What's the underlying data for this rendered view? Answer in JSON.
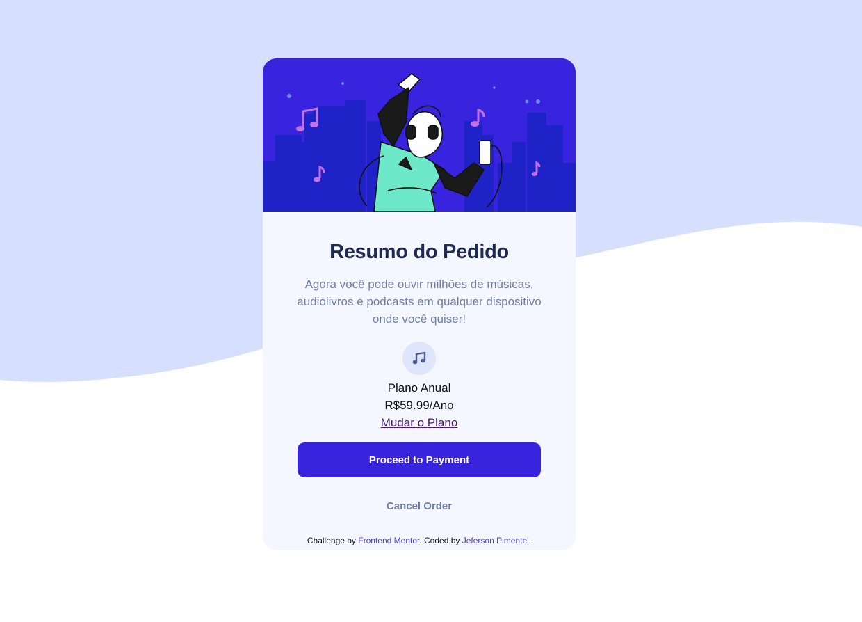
{
  "colors": {
    "page_background": "#ffffff",
    "wave": "#d6e0fe",
    "card_background": "#f4f7ff",
    "hero_background": "#3824de",
    "accent": "#3824de",
    "title": "#1e2a4f",
    "muted_text": "#717fa6",
    "link": "#4b1a7a",
    "icon_circle": "#dfe6fb"
  },
  "hero": {
    "illustration": "person-listening-music-illustration"
  },
  "summary": {
    "title": "Resumo do Pedido",
    "description": "Agora você pode ouvir milhões de músicas, audiolivros e podcasts em qualquer dispositivo onde você quiser!"
  },
  "plan": {
    "icon": "music-note-icon",
    "name": "Plano Anual",
    "price": "R$59.99/Ano",
    "change_link": "Mudar o Plano"
  },
  "actions": {
    "proceed_label": "Proceed to Payment",
    "cancel_label": "Cancel Order"
  },
  "attribution": {
    "prefix": "Challenge by",
    "challenge_link": "Frontend Mentor",
    "middle": ". Coded by",
    "author_link": "Jeferson Pimentel",
    "suffix": "."
  }
}
